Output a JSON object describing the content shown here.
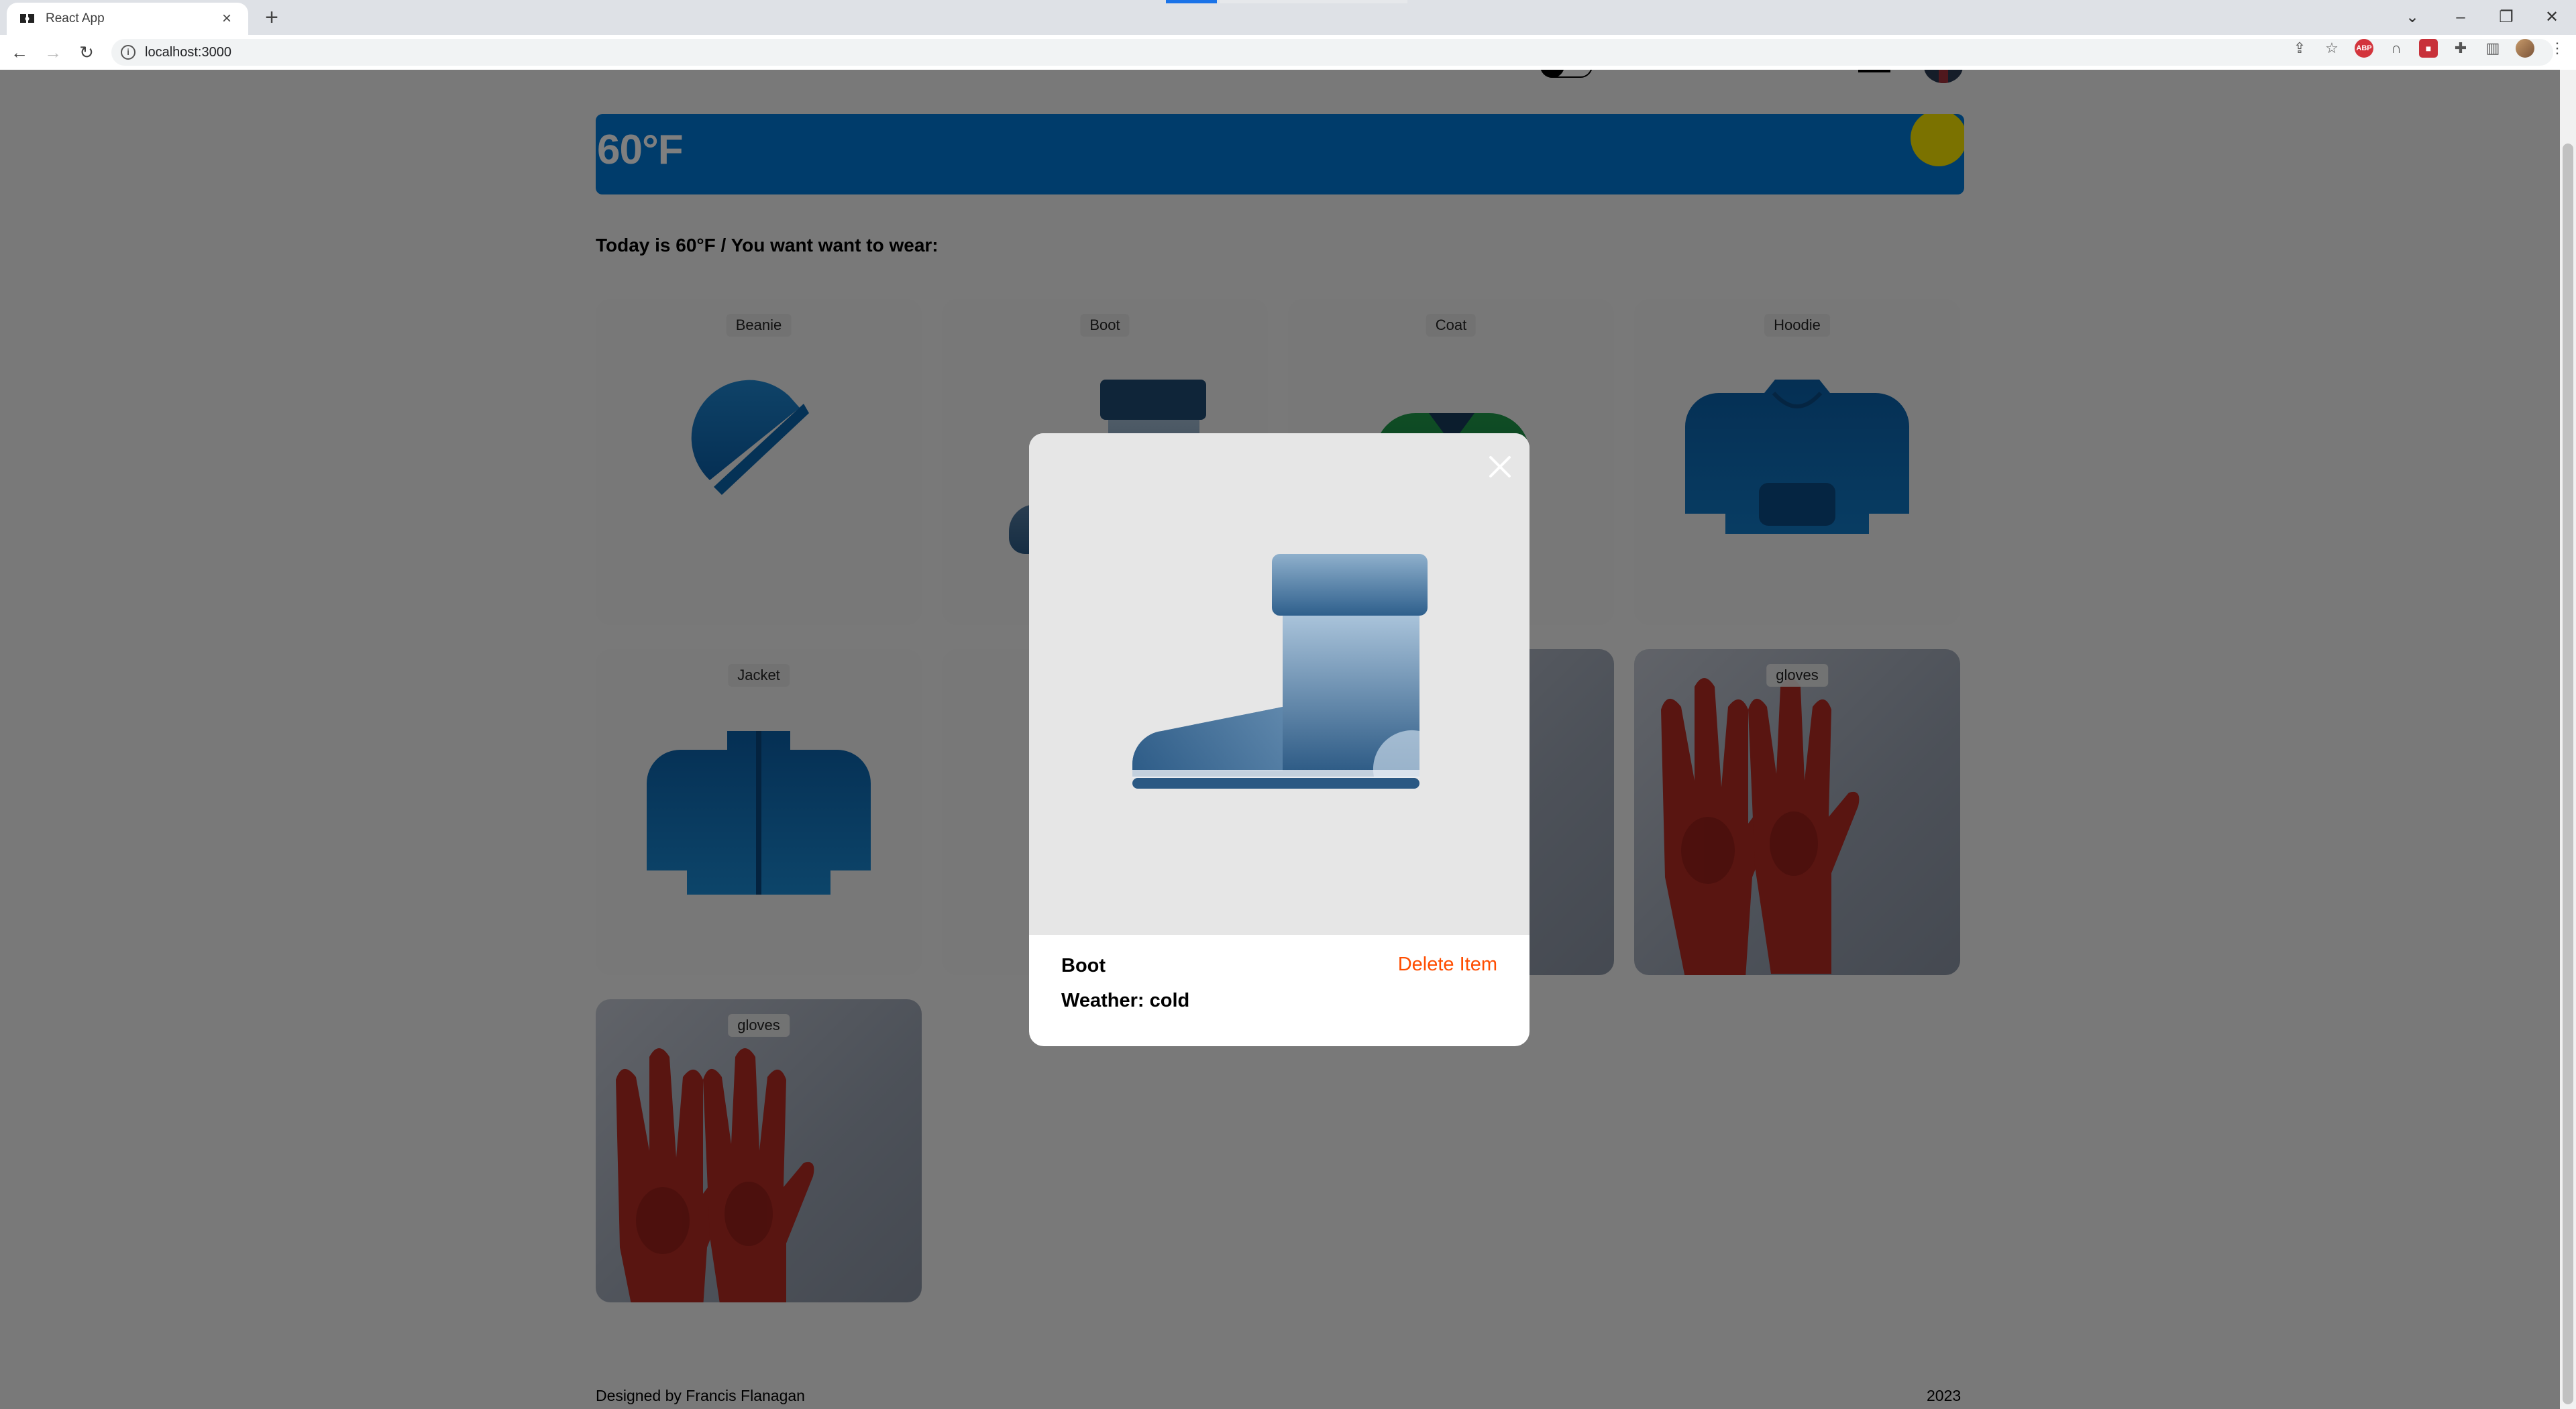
{
  "browser": {
    "tab_title": "React App",
    "url": "localhost:3000"
  },
  "page": {
    "weather_temp": "60°F",
    "today_text": "Today is 60°F / You want want to wear:",
    "cards": [
      {
        "label": "Beanie",
        "kind": "beanie-icon"
      },
      {
        "label": "Boot",
        "kind": "boot-icon"
      },
      {
        "label": "Coat",
        "kind": "coat-icon"
      },
      {
        "label": "Hoodie",
        "kind": "hoodie-icon"
      },
      {
        "label": "Jacket",
        "kind": "jacket-icon"
      },
      {
        "label": "gloves",
        "kind": "gloves-photo"
      },
      {
        "label": "gloves",
        "kind": "gloves-photo"
      }
    ],
    "footer_left": "Designed by Francis Flanagan",
    "footer_right": "2023"
  },
  "modal": {
    "item_name": "Boot",
    "weather": "Weather: cold",
    "delete_label": "Delete Item"
  },
  "colors": {
    "accent_blue": "#0078d7",
    "sun_yellow": "#f6e400",
    "delete_orange": "#ff4d00",
    "overlay": "rgba(0,0,0,0.5)"
  }
}
